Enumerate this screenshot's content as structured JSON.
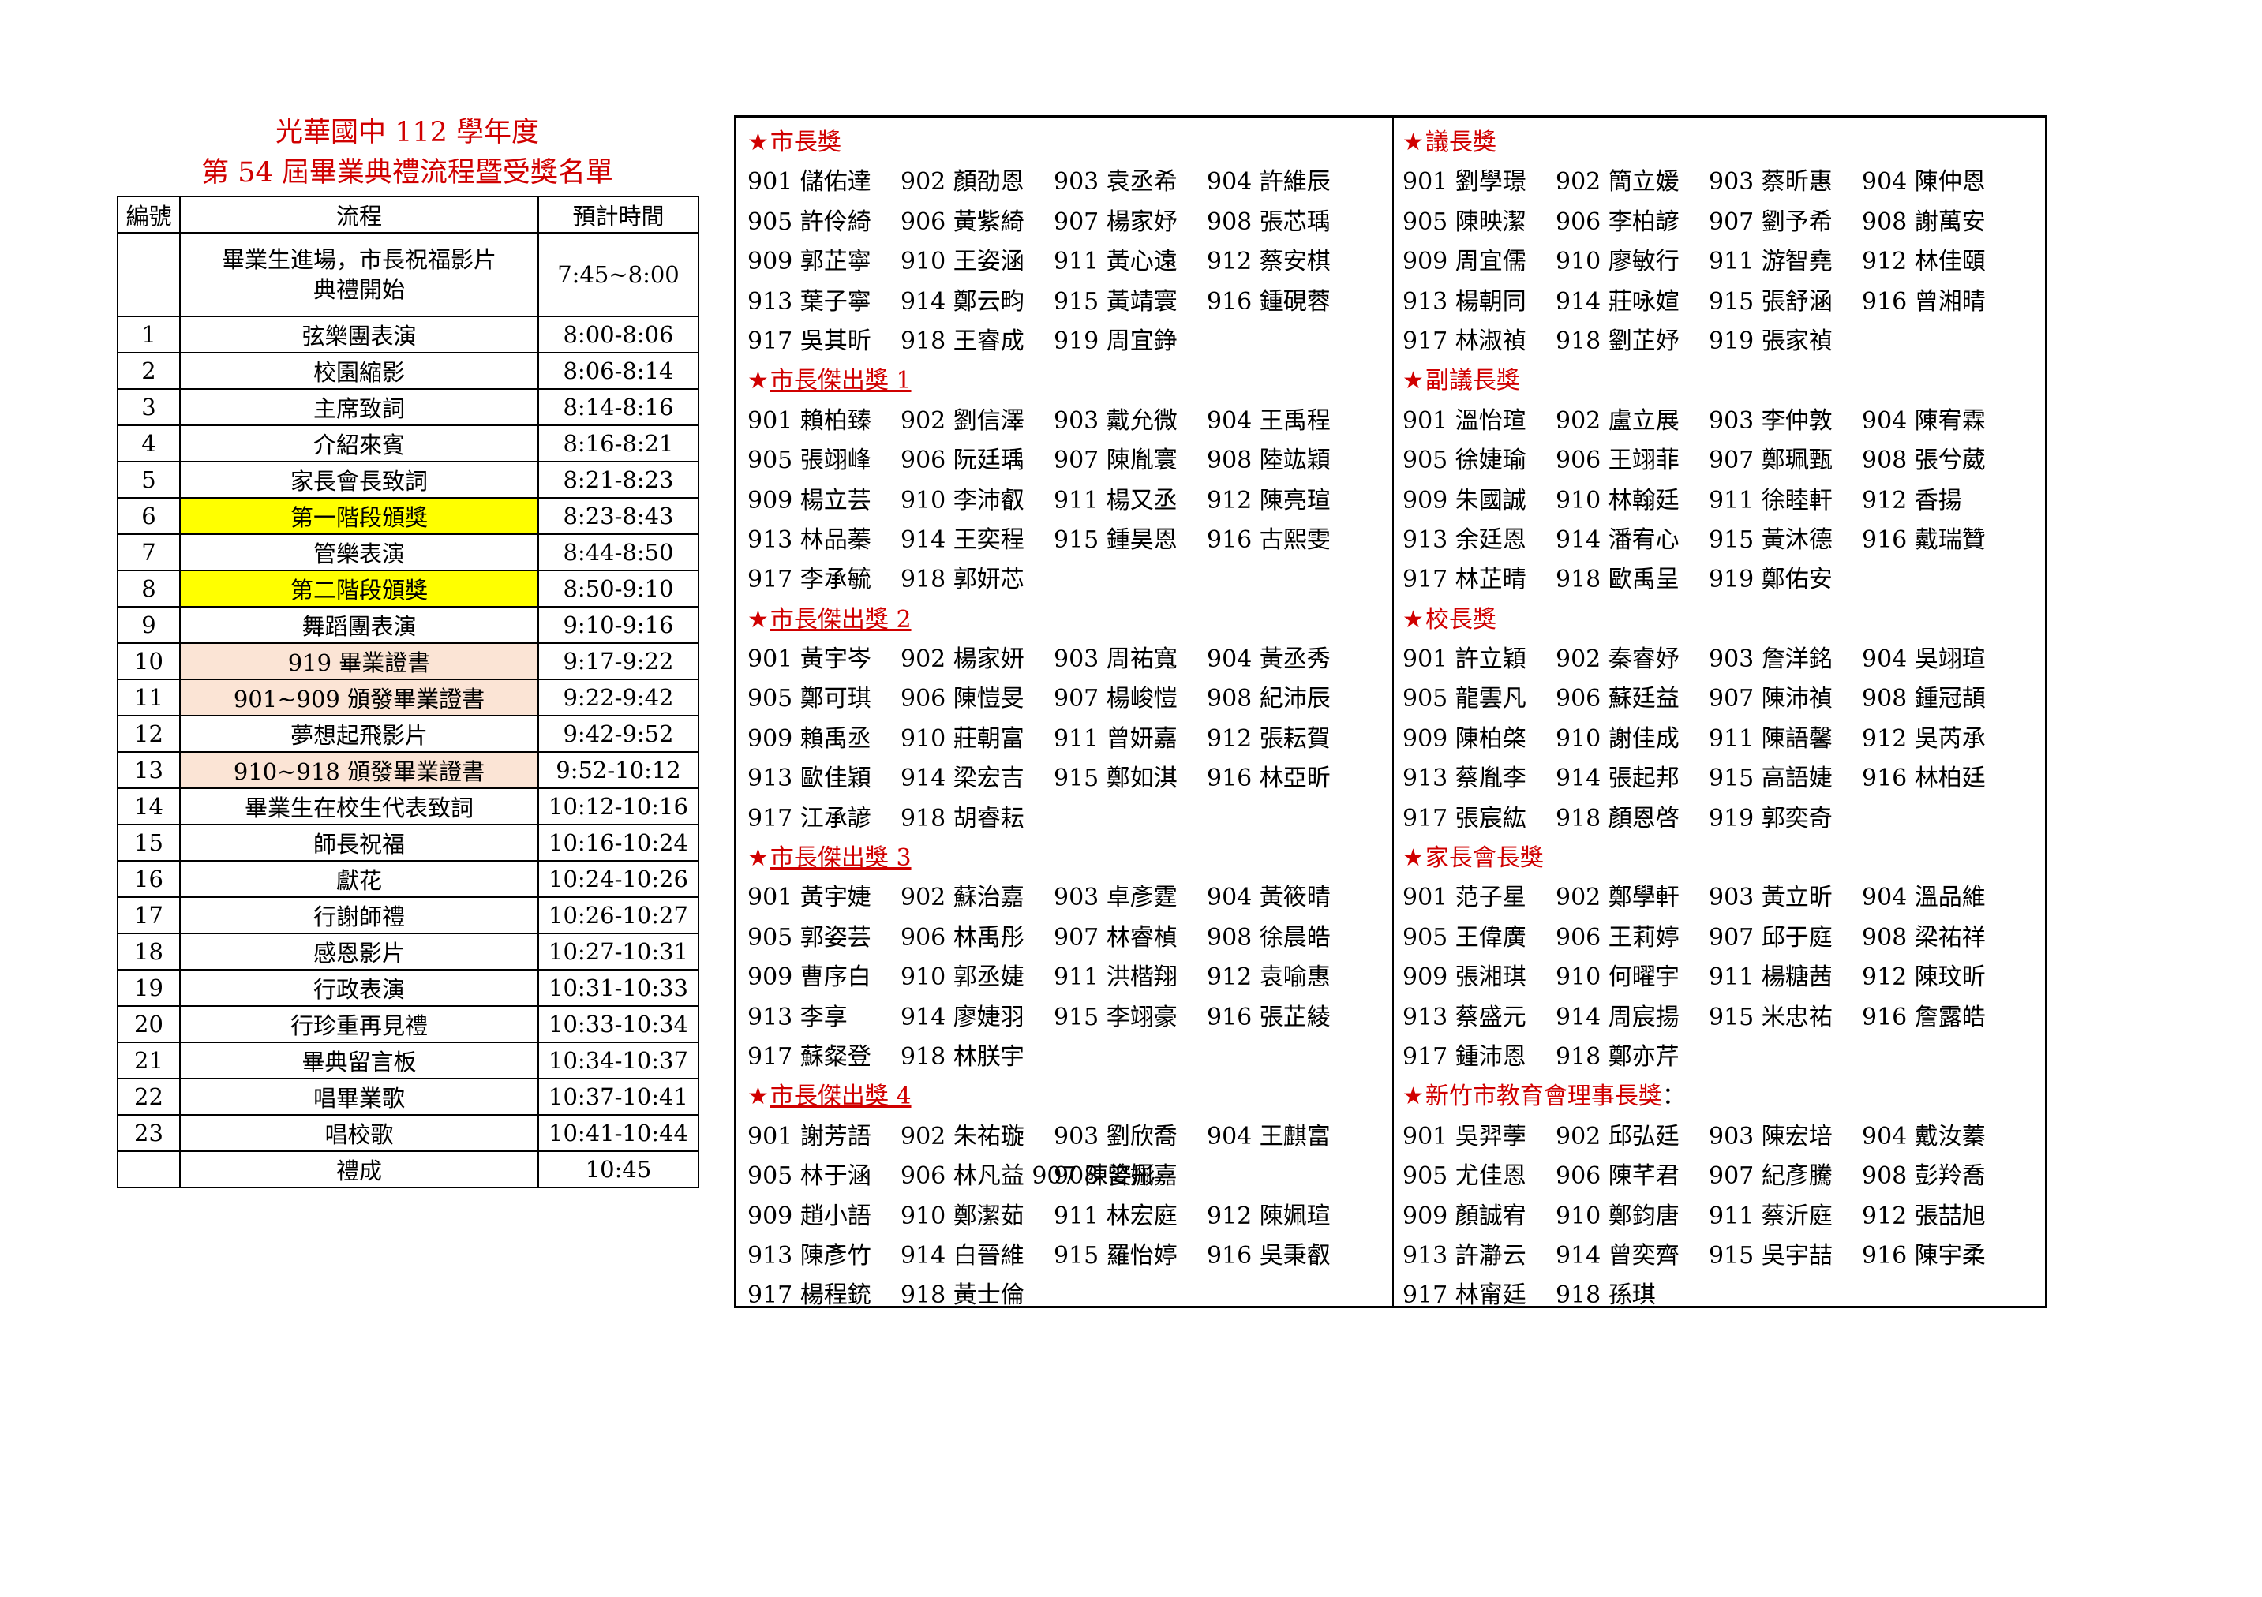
{
  "titles": {
    "line1": "光華國中 112 學年度",
    "line2": "第 54 屆畢業典禮流程暨受獎名單"
  },
  "schedule": {
    "headers": [
      "編號",
      "流程",
      "預計時間"
    ],
    "rows": [
      {
        "no": "",
        "item": "畢業生進場，市長祝福影片",
        "item2": "典禮開始",
        "time": "7:45~8:00",
        "hl": ""
      },
      {
        "no": "1",
        "item": "弦樂團表演",
        "time": "8:00-8:06",
        "hl": ""
      },
      {
        "no": "2",
        "item": "校園縮影",
        "time": "8:06-8:14",
        "hl": ""
      },
      {
        "no": "3",
        "item": "主席致詞",
        "time": "8:14-8:16",
        "hl": ""
      },
      {
        "no": "4",
        "item": "介紹來賓",
        "time": "8:16-8:21",
        "hl": ""
      },
      {
        "no": "5",
        "item": "家長會長致詞",
        "time": "8:21-8:23",
        "hl": ""
      },
      {
        "no": "6",
        "item": "第一階段頒獎",
        "time": "8:23-8:43",
        "hl": "yellow"
      },
      {
        "no": "7",
        "item": "管樂表演",
        "time": "8:44-8:50",
        "hl": ""
      },
      {
        "no": "8",
        "item": "第二階段頒獎",
        "time": "8:50-9:10",
        "hl": "yellow"
      },
      {
        "no": "9",
        "item": "舞蹈團表演",
        "time": "9:10-9:16",
        "hl": ""
      },
      {
        "no": "10",
        "item": "919 畢業證書",
        "time": "9:17-9:22",
        "hl": "peach"
      },
      {
        "no": "11",
        "item": "901~909 頒發畢業證書",
        "time": "9:22-9:42",
        "hl": "peach"
      },
      {
        "no": "12",
        "item": "夢想起飛影片",
        "time": "9:42-9:52",
        "hl": ""
      },
      {
        "no": "13",
        "item": "910~918 頒發畢業證書",
        "time": "9:52-10:12",
        "hl": "peach"
      },
      {
        "no": "14",
        "item": "畢業生在校生代表致詞",
        "time": "10:12-10:16",
        "hl": ""
      },
      {
        "no": "15",
        "item": "師長祝福",
        "time": "10:16-10:24",
        "hl": ""
      },
      {
        "no": "16",
        "item": "獻花",
        "time": "10:24-10:26",
        "hl": ""
      },
      {
        "no": "17",
        "item": "行謝師禮",
        "time": "10:26-10:27",
        "hl": ""
      },
      {
        "no": "18",
        "item": "感恩影片",
        "time": "10:27-10:31",
        "hl": ""
      },
      {
        "no": "19",
        "item": "行政表演",
        "time": "10:31-10:33",
        "hl": ""
      },
      {
        "no": "20",
        "item": "行珍重再見禮",
        "time": "10:33-10:34",
        "hl": ""
      },
      {
        "no": "21",
        "item": "畢典留言板",
        "time": "10:34-10:37",
        "hl": ""
      },
      {
        "no": "22",
        "item": "唱畢業歌",
        "time": "10:37-10:41",
        "hl": ""
      },
      {
        "no": "23",
        "item": "唱校歌",
        "time": "10:41-10:44",
        "hl": ""
      },
      {
        "no": "",
        "item": "禮成",
        "time": "10:45",
        "hl": ""
      }
    ]
  },
  "awards": {
    "left": [
      {
        "title": "市長獎",
        "underline": false,
        "rows": [
          [
            "901 儲佑達",
            "902 顏劭恩",
            "903 袁丞希",
            "904 許維辰"
          ],
          [
            "905 許伶綺",
            "906 黃紫綺",
            "907 楊家妤",
            "908 張芯瑀"
          ],
          [
            "909 郭芷寧",
            "910 王姿涵",
            "911 黃心遠",
            "912 蔡安棋"
          ],
          [
            "913 葉子寧",
            "914 鄭云畇",
            "915 黃靖寰",
            "916 鍾硯蓉"
          ],
          [
            "917 吳其昕",
            "918 王睿成",
            "919 周宜錚"
          ]
        ]
      },
      {
        "title": "市長傑出獎 1",
        "underline": true,
        "rows": [
          [
            "901 賴柏臻",
            "902 劉信澤",
            "903 戴允微",
            "904 王禹程"
          ],
          [
            "905 張翊峰",
            "906 阮廷瑀",
            "907 陳胤寰",
            "908 陸竑穎"
          ],
          [
            "909 楊立芸",
            "910 李沛叡",
            "911 楊又丞",
            "912 陳亮瑄"
          ],
          [
            "913 林品蓁",
            "914 王奕程",
            "915 鍾昊恩",
            "916 古熙雯"
          ],
          [
            "917 李承毓",
            "918 郭妍芯"
          ]
        ]
      },
      {
        "title": "市長傑出獎 2",
        "underline": true,
        "rows": [
          [
            "901 黃宇岑",
            "902 楊家妍",
            "903 周祐寬",
            "904 黃丞秀"
          ],
          [
            "905 鄭可琪",
            "906 陳愷旻",
            "907 楊峻愷",
            "908 紀沛辰"
          ],
          [
            "909 賴禹丞",
            "910 莊朝富",
            "911 曾妍嘉",
            "912 張耘賀"
          ],
          [
            "913 歐佳穎",
            "914 梁宏吉",
            "915 鄭如淇",
            "916 林亞昕"
          ],
          [
            "917 江承諺",
            "918 胡睿耘"
          ]
        ]
      },
      {
        "title": "市長傑出獎 3",
        "underline": true,
        "rows": [
          [
            "901 黃宇婕",
            "902 蘇治嘉",
            "903 卓彥霆",
            "904 黃筱晴"
          ],
          [
            "905 郭姿芸",
            "906 林禹彤",
            "907 林睿楨",
            "908 徐晨皓"
          ],
          [
            "909 曹序白",
            "910 郭丞婕",
            "911 洪楷翔",
            "912 袁喻惠"
          ],
          [
            "913 李享",
            "914 廖婕羽",
            "915 李翊豪",
            "916 張芷綾"
          ],
          [
            "917 蘇粲登",
            "918 林朕宇"
          ]
        ]
      },
      {
        "title": "市長傑出獎 4",
        "underline": true,
        "rows": [
          [
            "901 謝芳語",
            "902 朱祐璇",
            "903 劉欣喬",
            "904 王麒富"
          ],
          [
            "905 林于涵",
            "906 林凡益 907 陳姿彤",
            "908 曾姵嘉"
          ],
          [
            "909 趙小語",
            "910 鄭潔茹",
            "911 林宏庭",
            "912 陳姵瑄"
          ],
          [
            "913 陳彥竹",
            "914 白晉維",
            "915 羅怡婷",
            "916 吳秉叡"
          ],
          [
            "917 楊程銃",
            "918 黃士倫"
          ]
        ]
      }
    ],
    "right": [
      {
        "title": "議長獎",
        "underline": false,
        "rows": [
          [
            "901 劉學璟",
            "902 簡立媛",
            "903 蔡昕惠",
            "904 陳仲恩"
          ],
          [
            "905 陳映潔",
            "906 李柏諺",
            "907 劉予希",
            "908 謝萬安"
          ],
          [
            "909 周宜儒",
            "910 廖敏行",
            "911 游智堯",
            "912 林佳頤"
          ],
          [
            "913 楊朝同",
            "914 莊咏媗",
            "915 張舒涵",
            "916 曾湘晴"
          ],
          [
            "917 林淑禎",
            "918 劉芷妤",
            "919 張家禎"
          ]
        ]
      },
      {
        "title": "副議長獎",
        "underline": false,
        "rows": [
          [
            "901 溫怡瑄",
            "902 盧立展",
            "903 李仲敦",
            "904 陳宥霖"
          ],
          [
            "905 徐婕瑜",
            "906 王翊菲",
            "907 鄭珮甄",
            "908 張兮葳"
          ],
          [
            "909 朱國誠",
            "910 林翰廷",
            "911 徐睦軒",
            "912 香揚"
          ],
          [
            "913 余廷恩",
            "914 潘宥心",
            "915 黃沐德",
            "916 戴瑞贊"
          ],
          [
            "917 林芷晴",
            "918 歐禹呈",
            "919 鄭佑安"
          ]
        ]
      },
      {
        "title": "校長獎",
        "underline": false,
        "rows": [
          [
            "901 許立穎",
            "902 秦睿妤",
            "903 詹洋銘",
            "904 吳翊瑄"
          ],
          [
            "905 龍雲凡",
            "906 蘇廷益",
            "907 陳沛禎",
            "908 鍾冠頡"
          ],
          [
            "909 陳柏棨",
            "910 謝佳成",
            "911 陳語馨",
            "912 吳芮承"
          ],
          [
            "913 蔡胤李",
            "914 張起邦",
            "915 高語婕",
            "916 林柏廷"
          ],
          [
            "917 張宸紘",
            "918 顏恩啓",
            "919 郭奕奇"
          ]
        ]
      },
      {
        "title": "家長會長獎",
        "underline": false,
        "rows": [
          [
            "901 范子星",
            "902 鄭學軒",
            "903 黃立昕",
            "904 溫品維"
          ],
          [
            "905 王偉廣",
            "906 王莉婷",
            "907 邱于庭",
            "908 梁祐祥"
          ],
          [
            "909 張湘琪",
            "910 何曜宇",
            "911 楊糖茜",
            "912 陳玟昕"
          ],
          [
            "913 蔡盛元",
            "914 周宸揚",
            "915 米忠祐",
            "916 詹露皓"
          ],
          [
            "917 鍾沛恩",
            "918 鄭亦芹"
          ]
        ]
      },
      {
        "title": "新竹市教育會理事長獎",
        "underline": false,
        "colon": "：",
        "rows": [
          [
            "901 吳羿荸",
            "902 邱弘廷",
            "903 陳宏培",
            "904 戴汝蓁"
          ],
          [
            "905 尤佳恩",
            "906 陳芊君",
            "907 紀彥騰",
            "908 彭羚喬"
          ],
          [
            "909 顏誠宥",
            "910 鄭鈞唐",
            "911 蔡沂庭",
            "912 張喆旭"
          ],
          [
            "913 許瀞云",
            "914 曾奕齊",
            "915 吳宇喆",
            "916 陳宇柔"
          ],
          [
            "917 林甯廷",
            "918 孫琪"
          ]
        ]
      }
    ]
  }
}
